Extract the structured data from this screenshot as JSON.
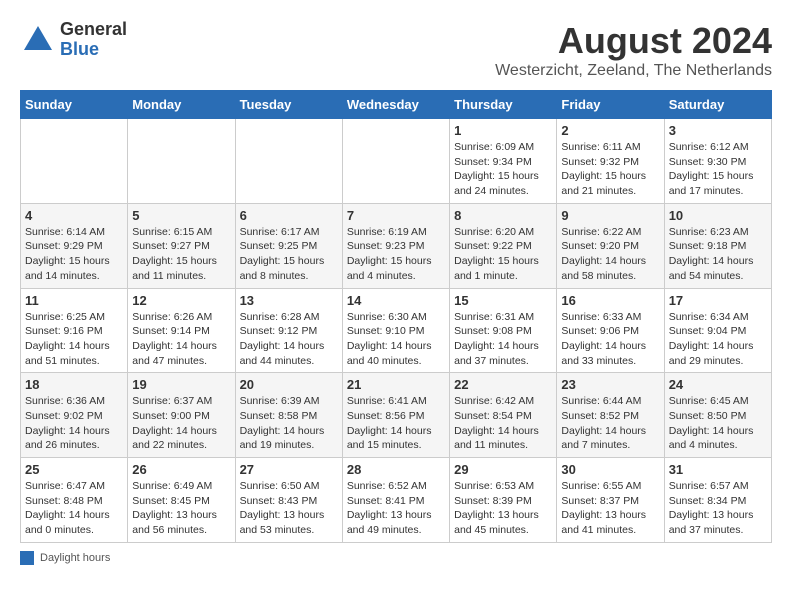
{
  "header": {
    "logo_general": "General",
    "logo_blue": "Blue",
    "month_title": "August 2024",
    "location": "Westerzicht, Zeeland, The Netherlands"
  },
  "days_of_week": [
    "Sunday",
    "Monday",
    "Tuesday",
    "Wednesday",
    "Thursday",
    "Friday",
    "Saturday"
  ],
  "legend_text": "Daylight hours",
  "weeks": [
    [
      {
        "day": "",
        "info": ""
      },
      {
        "day": "",
        "info": ""
      },
      {
        "day": "",
        "info": ""
      },
      {
        "day": "",
        "info": ""
      },
      {
        "day": "1",
        "info": "Sunrise: 6:09 AM\nSunset: 9:34 PM\nDaylight: 15 hours and 24 minutes."
      },
      {
        "day": "2",
        "info": "Sunrise: 6:11 AM\nSunset: 9:32 PM\nDaylight: 15 hours and 21 minutes."
      },
      {
        "day": "3",
        "info": "Sunrise: 6:12 AM\nSunset: 9:30 PM\nDaylight: 15 hours and 17 minutes."
      }
    ],
    [
      {
        "day": "4",
        "info": "Sunrise: 6:14 AM\nSunset: 9:29 PM\nDaylight: 15 hours and 14 minutes."
      },
      {
        "day": "5",
        "info": "Sunrise: 6:15 AM\nSunset: 9:27 PM\nDaylight: 15 hours and 11 minutes."
      },
      {
        "day": "6",
        "info": "Sunrise: 6:17 AM\nSunset: 9:25 PM\nDaylight: 15 hours and 8 minutes."
      },
      {
        "day": "7",
        "info": "Sunrise: 6:19 AM\nSunset: 9:23 PM\nDaylight: 15 hours and 4 minutes."
      },
      {
        "day": "8",
        "info": "Sunrise: 6:20 AM\nSunset: 9:22 PM\nDaylight: 15 hours and 1 minute."
      },
      {
        "day": "9",
        "info": "Sunrise: 6:22 AM\nSunset: 9:20 PM\nDaylight: 14 hours and 58 minutes."
      },
      {
        "day": "10",
        "info": "Sunrise: 6:23 AM\nSunset: 9:18 PM\nDaylight: 14 hours and 54 minutes."
      }
    ],
    [
      {
        "day": "11",
        "info": "Sunrise: 6:25 AM\nSunset: 9:16 PM\nDaylight: 14 hours and 51 minutes."
      },
      {
        "day": "12",
        "info": "Sunrise: 6:26 AM\nSunset: 9:14 PM\nDaylight: 14 hours and 47 minutes."
      },
      {
        "day": "13",
        "info": "Sunrise: 6:28 AM\nSunset: 9:12 PM\nDaylight: 14 hours and 44 minutes."
      },
      {
        "day": "14",
        "info": "Sunrise: 6:30 AM\nSunset: 9:10 PM\nDaylight: 14 hours and 40 minutes."
      },
      {
        "day": "15",
        "info": "Sunrise: 6:31 AM\nSunset: 9:08 PM\nDaylight: 14 hours and 37 minutes."
      },
      {
        "day": "16",
        "info": "Sunrise: 6:33 AM\nSunset: 9:06 PM\nDaylight: 14 hours and 33 minutes."
      },
      {
        "day": "17",
        "info": "Sunrise: 6:34 AM\nSunset: 9:04 PM\nDaylight: 14 hours and 29 minutes."
      }
    ],
    [
      {
        "day": "18",
        "info": "Sunrise: 6:36 AM\nSunset: 9:02 PM\nDaylight: 14 hours and 26 minutes."
      },
      {
        "day": "19",
        "info": "Sunrise: 6:37 AM\nSunset: 9:00 PM\nDaylight: 14 hours and 22 minutes."
      },
      {
        "day": "20",
        "info": "Sunrise: 6:39 AM\nSunset: 8:58 PM\nDaylight: 14 hours and 19 minutes."
      },
      {
        "day": "21",
        "info": "Sunrise: 6:41 AM\nSunset: 8:56 PM\nDaylight: 14 hours and 15 minutes."
      },
      {
        "day": "22",
        "info": "Sunrise: 6:42 AM\nSunset: 8:54 PM\nDaylight: 14 hours and 11 minutes."
      },
      {
        "day": "23",
        "info": "Sunrise: 6:44 AM\nSunset: 8:52 PM\nDaylight: 14 hours and 7 minutes."
      },
      {
        "day": "24",
        "info": "Sunrise: 6:45 AM\nSunset: 8:50 PM\nDaylight: 14 hours and 4 minutes."
      }
    ],
    [
      {
        "day": "25",
        "info": "Sunrise: 6:47 AM\nSunset: 8:48 PM\nDaylight: 14 hours and 0 minutes."
      },
      {
        "day": "26",
        "info": "Sunrise: 6:49 AM\nSunset: 8:45 PM\nDaylight: 13 hours and 56 minutes."
      },
      {
        "day": "27",
        "info": "Sunrise: 6:50 AM\nSunset: 8:43 PM\nDaylight: 13 hours and 53 minutes."
      },
      {
        "day": "28",
        "info": "Sunrise: 6:52 AM\nSunset: 8:41 PM\nDaylight: 13 hours and 49 minutes."
      },
      {
        "day": "29",
        "info": "Sunrise: 6:53 AM\nSunset: 8:39 PM\nDaylight: 13 hours and 45 minutes."
      },
      {
        "day": "30",
        "info": "Sunrise: 6:55 AM\nSunset: 8:37 PM\nDaylight: 13 hours and 41 minutes."
      },
      {
        "day": "31",
        "info": "Sunrise: 6:57 AM\nSunset: 8:34 PM\nDaylight: 13 hours and 37 minutes."
      }
    ]
  ]
}
